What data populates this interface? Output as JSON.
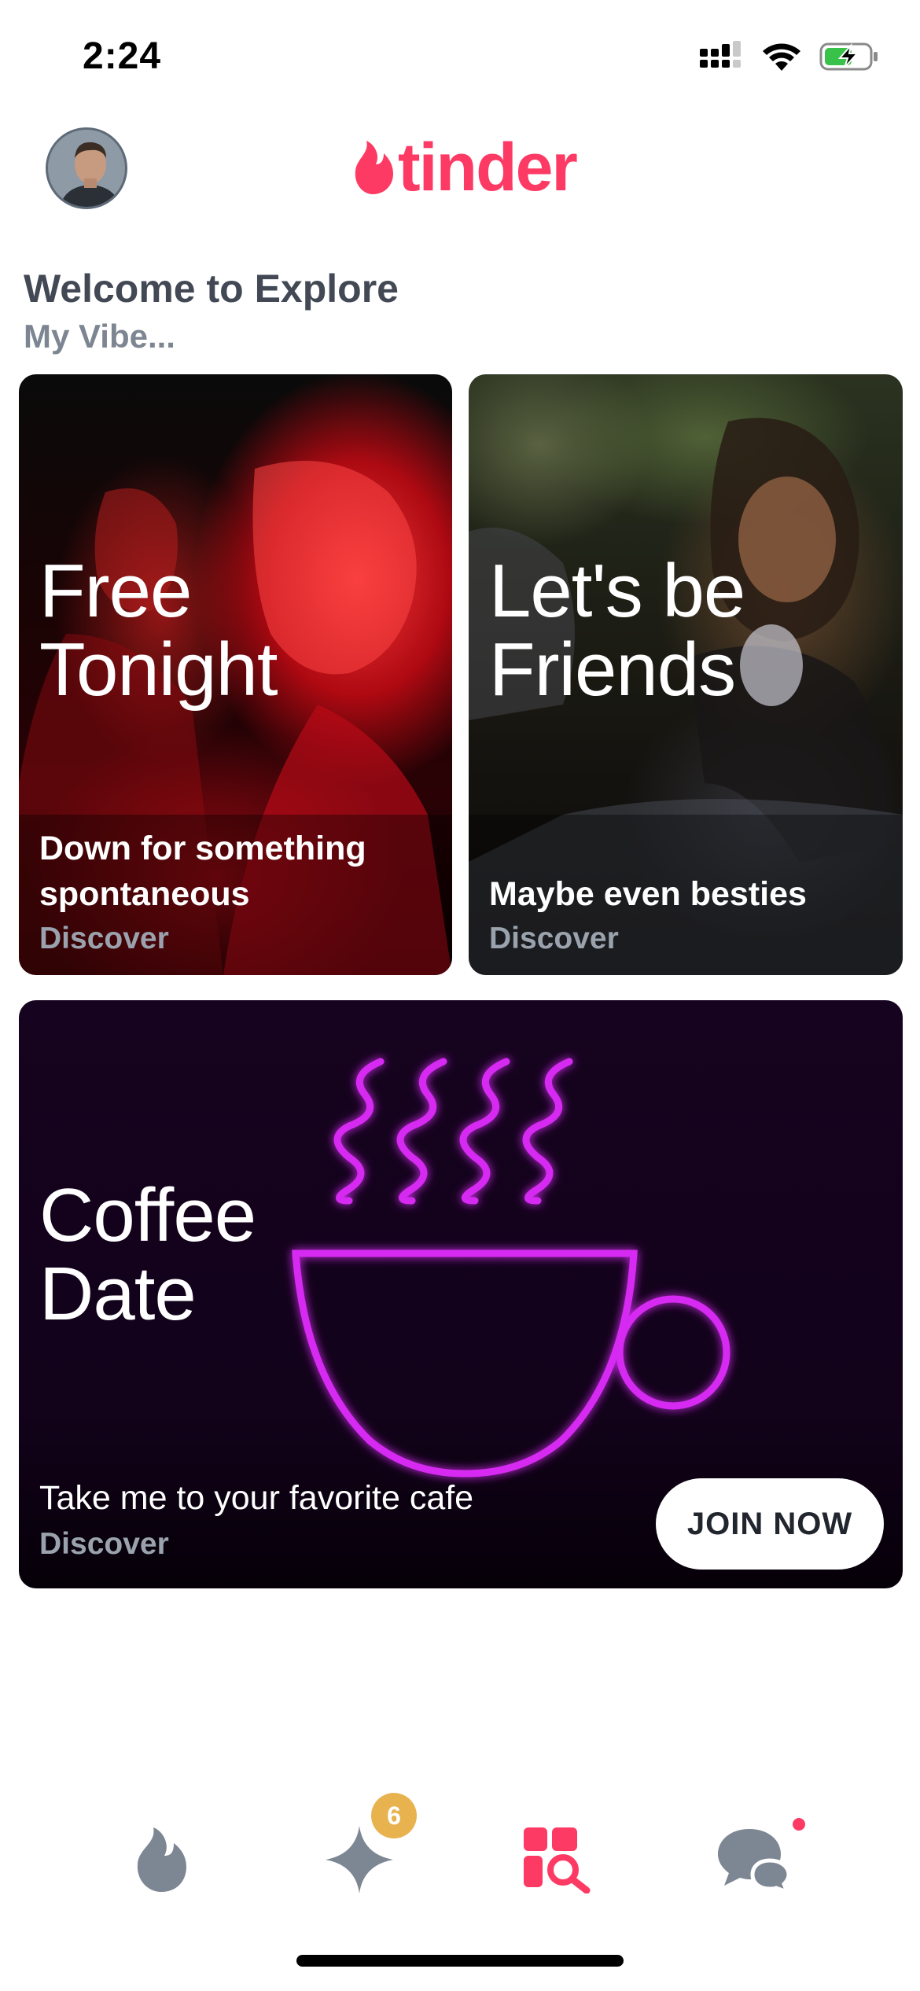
{
  "status_bar": {
    "time": "2:24"
  },
  "header": {
    "logo_text": "tinder",
    "brand_color": "#fd3a64"
  },
  "section": {
    "title": "Welcome to Explore",
    "subtitle": "My Vibe..."
  },
  "cards": [
    {
      "title_line1": "Free",
      "title_line2": "Tonight",
      "subtitle_line1": "Down for something",
      "subtitle_line2": "spontaneous",
      "discover": "Discover"
    },
    {
      "title_line1": "Let's be",
      "title_line2": "Friends",
      "subtitle": "Maybe even besties",
      "discover": "Discover"
    },
    {
      "title_line1": "Coffee",
      "title_line2": "Date",
      "subtitle": "Take me to your favorite cafe",
      "discover": "Discover",
      "button_label": "JOIN NOW",
      "neon_color": "#d62cf2"
    }
  ],
  "bottom_nav": {
    "items": [
      {
        "icon": "flame-icon",
        "active": false
      },
      {
        "icon": "sparkle-icon",
        "active": false,
        "badge": "6"
      },
      {
        "icon": "explore-icon",
        "active": true
      },
      {
        "icon": "chat-icon",
        "active": false,
        "dot": true
      }
    ],
    "badge_color": "#e8b34e",
    "inactive_color": "#7d8693",
    "active_color": "#fd3a64"
  }
}
